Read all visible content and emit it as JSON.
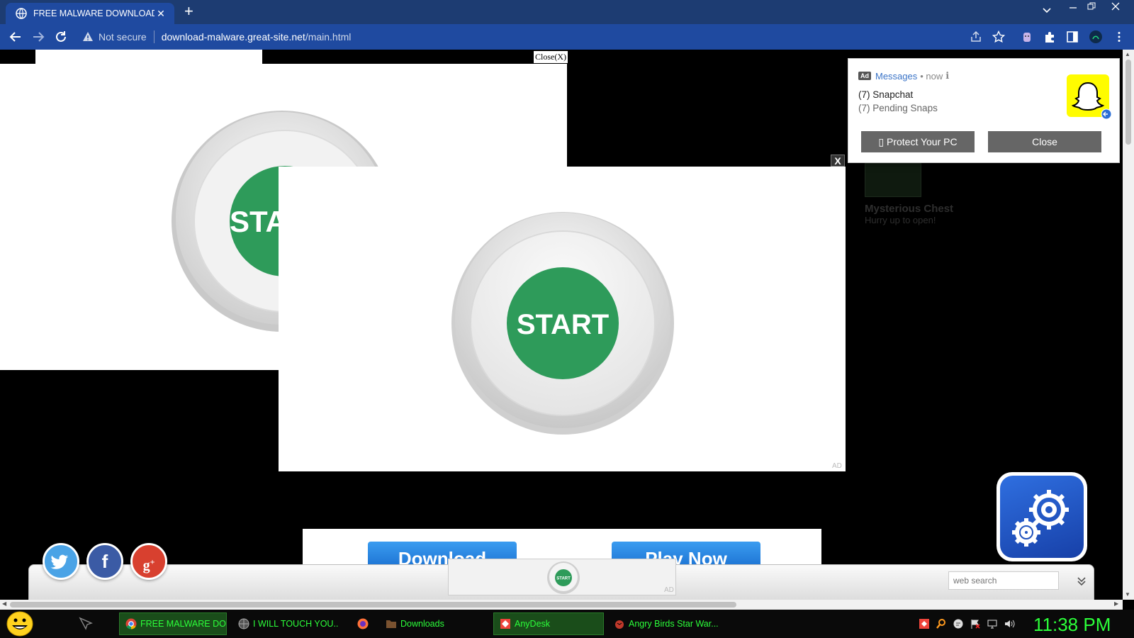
{
  "browser": {
    "tab_title": "FREE MALWARE DOWNLOAD",
    "tab_close": "✕",
    "new_tab": "+",
    "security_label": "Not secure",
    "url_host": "download-malware.great-site.net",
    "url_path": "/main.html"
  },
  "page": {
    "close_link": "Close(X)",
    "popup_close": "X",
    "start_label": "START",
    "start_label_partial": "STA",
    "ad_label": "AD",
    "ghost_card": {
      "title": "Mysterious Chest",
      "subtitle": "Hurry up to open!"
    },
    "notification": {
      "app": "Messages",
      "time": "• now",
      "time_suffix": "ℹ",
      "line1": "(7) Snapchat",
      "line2": "(7) Pending Snaps",
      "button_protect": "▯ Protect Your PC",
      "button_close": "Close"
    },
    "download_button": "Download",
    "play_button": "Play Now",
    "mini_ad_label": "START",
    "search_placeholder": "web search"
  },
  "taskbar": {
    "items": [
      {
        "label": "FREE MALWARE DO...",
        "icon": "chrome-icon"
      },
      {
        "label": "I WILL TOUCH YOU...",
        "icon": "globe-icon"
      },
      {
        "label": "",
        "icon": "firefox-icon"
      },
      {
        "label": "Downloads",
        "icon": "folder-icon"
      },
      {
        "label": "AnyDesk",
        "icon": "anydesk-icon"
      },
      {
        "label": "Angry Birds Star War...",
        "icon": "angry-birds-icon"
      }
    ],
    "clock": "11:38 PM"
  },
  "colors": {
    "chrome_title": "#1d3c72",
    "chrome_toolbar": "#1f4aa0",
    "start_green": "#2e9b5a",
    "taskbar_text": "#2cff3a"
  }
}
